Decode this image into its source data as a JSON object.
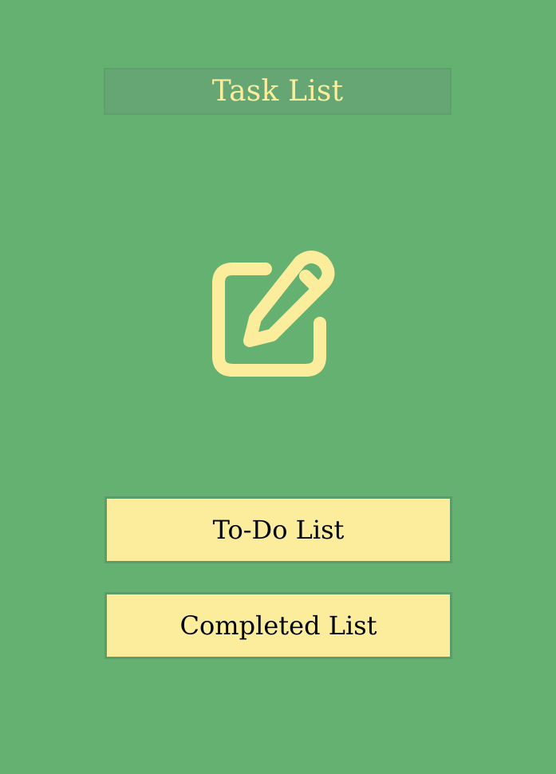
{
  "header": {
    "title": "Task List"
  },
  "hero": {
    "icon": "edit-icon"
  },
  "menu": {
    "todo_label": "To-Do List",
    "completed_label": "Completed List"
  },
  "colors": {
    "background": "#65b172",
    "accent": "#fbed9c",
    "title_box": "#66a674",
    "button_border": "#5a9d69",
    "button_text": "#000000"
  }
}
